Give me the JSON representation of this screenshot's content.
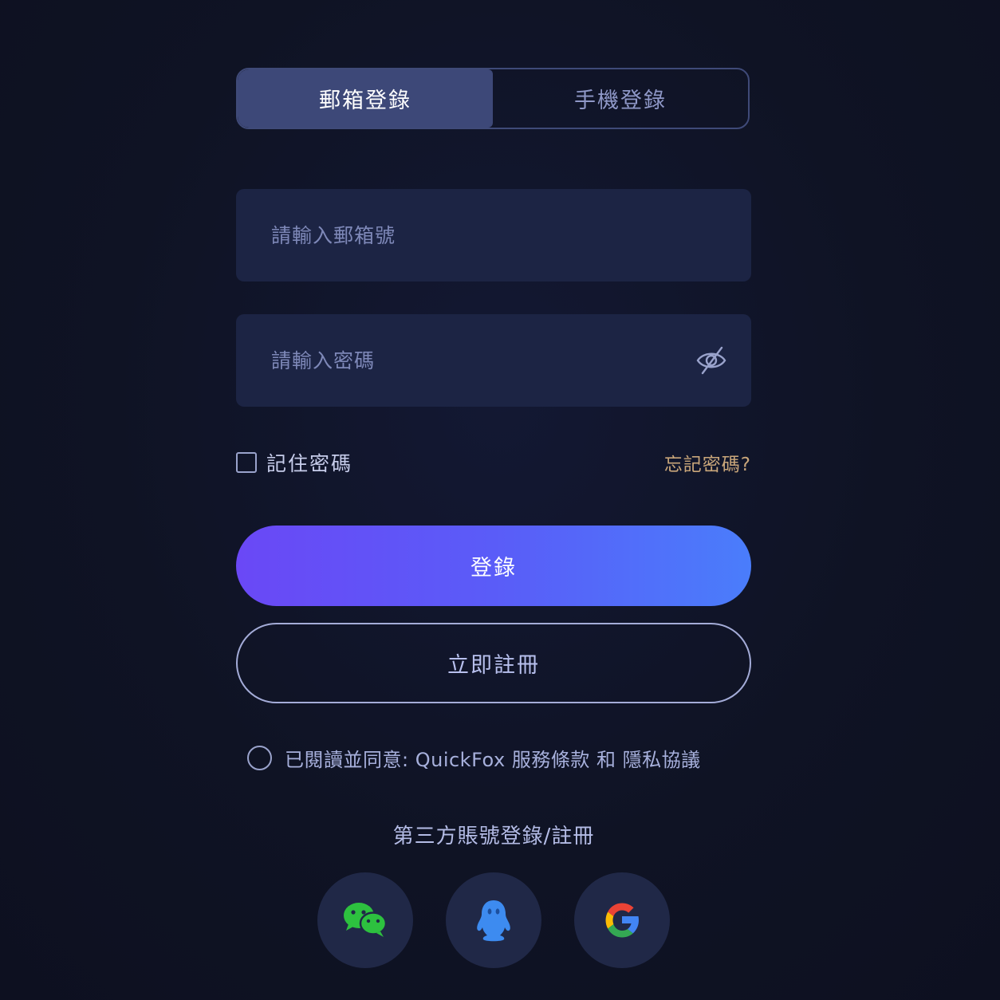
{
  "tabs": {
    "email_label": "郵箱登錄",
    "phone_label": "手機登錄"
  },
  "email_field": {
    "placeholder": "請輸入郵箱號",
    "value": ""
  },
  "password_field": {
    "placeholder": "請輸入密碼",
    "value": "",
    "toggle_icon": "eye-hidden-icon"
  },
  "remember": {
    "label": "記住密碼",
    "checked": false
  },
  "forgot_label": "忘記密碼?",
  "login_button": "登錄",
  "register_button": "立即註冊",
  "agreement": {
    "prefix": "已閱讀並同意: QuickFox",
    "terms": "服務條款",
    "and": "和",
    "privacy": "隱私協議",
    "checked": false
  },
  "third_party": {
    "title": "第三方賬號登錄/註冊",
    "providers": [
      {
        "icon": "wechat-icon",
        "color": "#2dc13f"
      },
      {
        "icon": "qq-icon",
        "color": "#3d8bf0"
      },
      {
        "icon": "google-icon",
        "color": "#4285f4"
      }
    ]
  },
  "colors": {
    "background": "#0f1324",
    "field": "#1c2444",
    "accent_start": "#6a48f6",
    "accent_end": "#4a7dfb",
    "forgot": "#c9a67a"
  }
}
